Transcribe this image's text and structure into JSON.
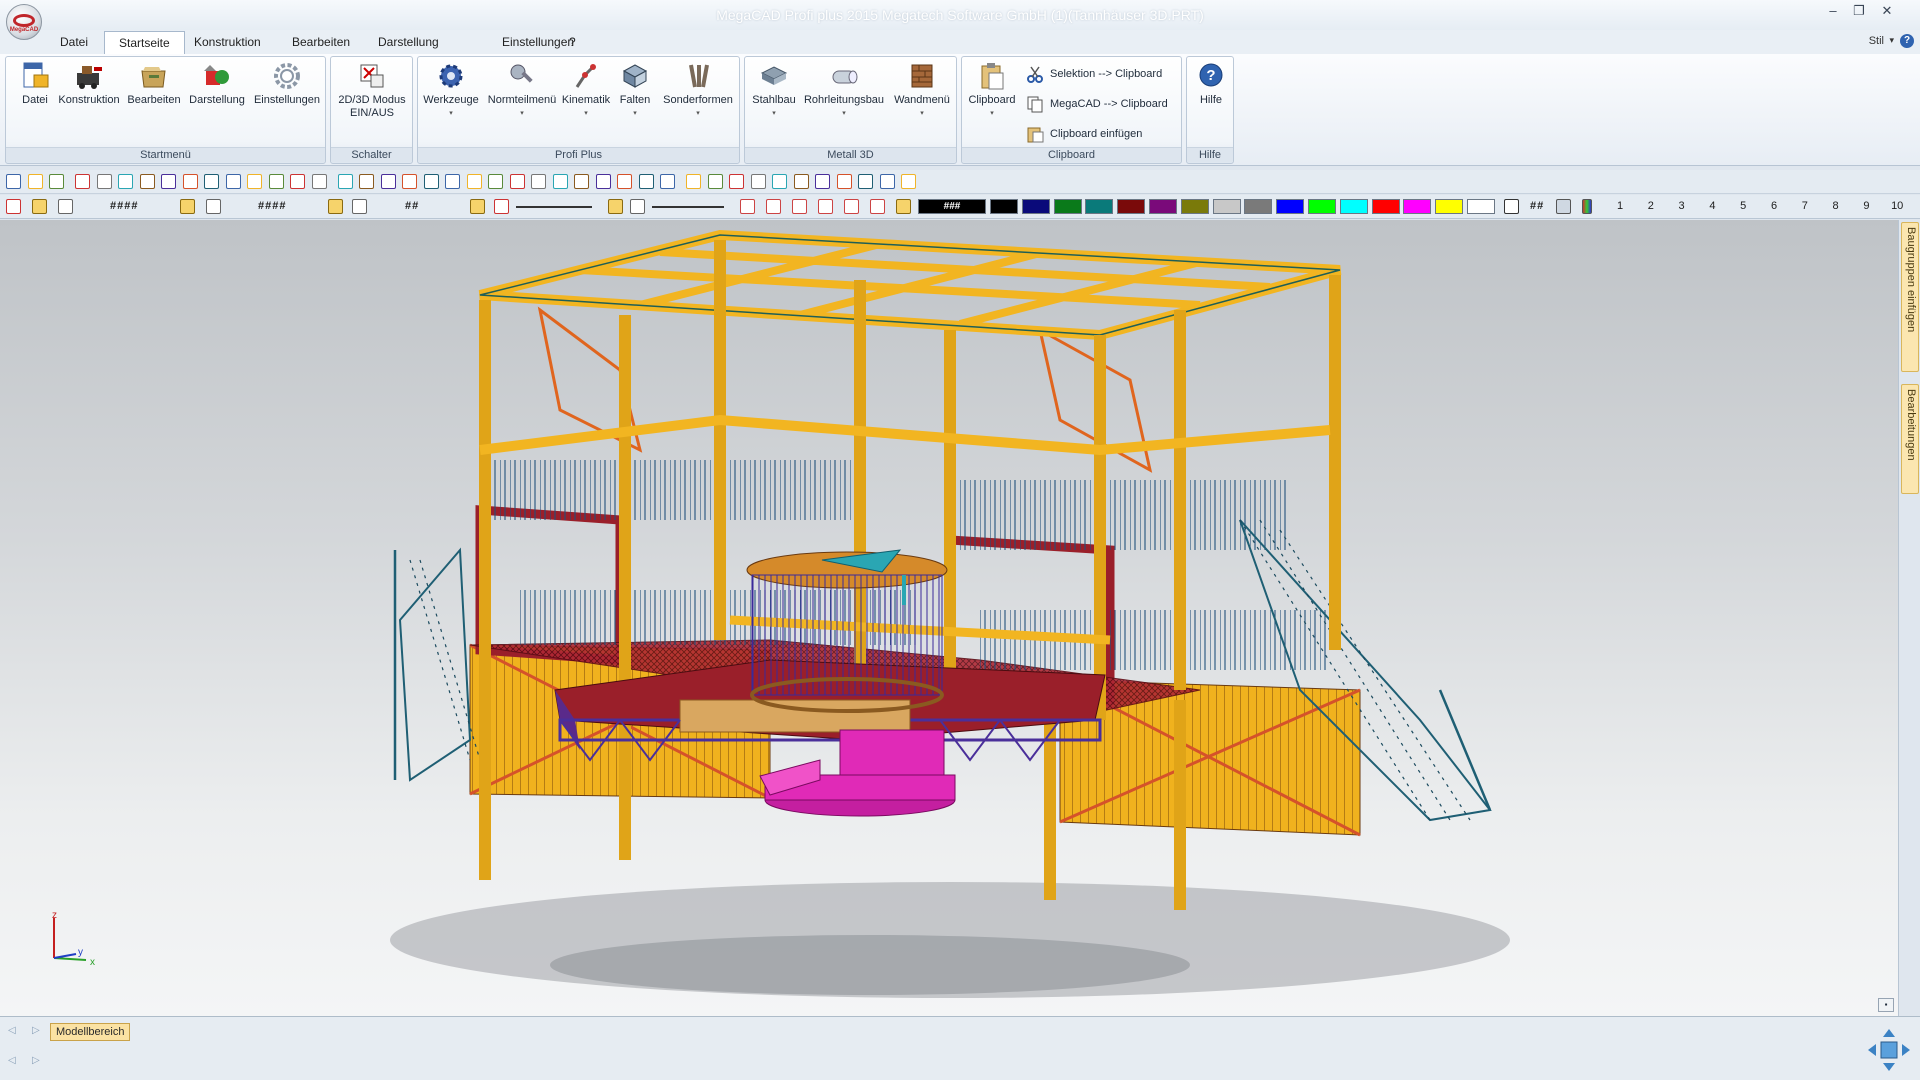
{
  "window": {
    "title": "MegaCAD Profi plus 2015  Megatech Software GmbH (1)(Tannhäuser 3D.PRT)",
    "logo_text": "MegaCAD",
    "minimize": "–",
    "restore": "❐",
    "close": "✕"
  },
  "menu": {
    "tabs": [
      {
        "label": "Datei"
      },
      {
        "label": "Startseite"
      },
      {
        "label": "Konstruktion"
      },
      {
        "label": "Bearbeiten"
      },
      {
        "label": "Darstellung"
      },
      {
        "label": "Einstellungen"
      },
      {
        "label": "?"
      }
    ],
    "active_tab": "Startseite",
    "style_label": "Stil",
    "style_arrow": "▾",
    "help_mini": "?"
  },
  "ribbon": {
    "groups": [
      {
        "label": "Startmenü",
        "buttons": [
          {
            "label": "Datei",
            "icon": "file-icon"
          },
          {
            "label": "Konstruktion",
            "icon": "construction-icon"
          },
          {
            "label": "Bearbeiten",
            "icon": "edit-icon"
          },
          {
            "label": "Darstellung",
            "icon": "display-icon"
          },
          {
            "label": "Einstellungen",
            "icon": "gear-icon"
          }
        ]
      },
      {
        "label": "Schalter",
        "buttons": [
          {
            "label": "2D/3D Modus",
            "label2": "EIN/AUS",
            "icon": "mode-toggle-icon"
          }
        ]
      },
      {
        "label": "Profi Plus",
        "buttons": [
          {
            "label": "Werkzeuge",
            "icon": "tools-icon",
            "dd": "▾"
          },
          {
            "label": "Normteilmenü",
            "icon": "standard-parts-icon",
            "dd": "▾"
          },
          {
            "label": "Kinematik",
            "icon": "kinematics-icon",
            "dd": "▾"
          },
          {
            "label": "Falten",
            "icon": "fold-icon",
            "dd": "▾"
          },
          {
            "label": "Sonderformen",
            "icon": "special-shapes-icon",
            "dd": "▾"
          }
        ]
      },
      {
        "label": "Metall 3D",
        "buttons": [
          {
            "label": "Stahlbau",
            "icon": "steel-construction-icon",
            "dd": "▾"
          },
          {
            "label": "Rohrleitungsbau",
            "icon": "pipe-icon",
            "dd": "▾"
          },
          {
            "label": "Wandmenü",
            "icon": "wall-icon",
            "dd": "▾"
          }
        ]
      },
      {
        "label": "Clipboard",
        "buttons": [
          {
            "label": "Clipboard",
            "icon": "clipboard-icon",
            "dd": "▾"
          }
        ],
        "small_buttons": [
          {
            "label": "Selektion --> Clipboard",
            "icon": "scissors-icon"
          },
          {
            "label": "MegaCAD --> Clipboard",
            "icon": "copy-icon"
          },
          {
            "label": "Clipboard einfügen",
            "icon": "paste-icon"
          }
        ]
      },
      {
        "label": "Hilfe",
        "buttons": [
          {
            "label": "Hilfe",
            "icon": "help-icon"
          }
        ]
      }
    ]
  },
  "toolbar2": {
    "field1": "####",
    "field2": "####",
    "field3": "##",
    "color_field": "###",
    "hash_label": "##",
    "colors": [
      "#000000",
      "#0a0a7a",
      "#0a7a1a",
      "#0a7a7a",
      "#7a0a0a",
      "#7a0a7a",
      "#7a7a0a",
      "#c8c8c8",
      "#7a7a7a",
      "#0000ff",
      "#00ff00",
      "#00ffff",
      "#ff0000",
      "#ff00ff",
      "#ffff00",
      "#ffffff"
    ],
    "layers": [
      "1",
      "2",
      "3",
      "4",
      "5",
      "6",
      "7",
      "8",
      "9",
      "10"
    ]
  },
  "viewport": {
    "axis_x": "x",
    "axis_y": "y",
    "axis_z": "z",
    "scroll_btn": "▪"
  },
  "side_tabs": [
    {
      "label": "Baugruppen einfügen"
    },
    {
      "label": "Bearbeitungen"
    }
  ],
  "sheetbar": {
    "active_sheet": "Modellbereich",
    "nav_left": "◁",
    "nav_right": "▷"
  },
  "accent": {
    "ribbon_border": "#bcc9d8",
    "sheet_tab": "#fbe2a3",
    "steel_yellow": "#f2b521",
    "steel_red": "#9a1f2a",
    "teal": "#1f6f78",
    "magenta": "#e02ab7"
  }
}
